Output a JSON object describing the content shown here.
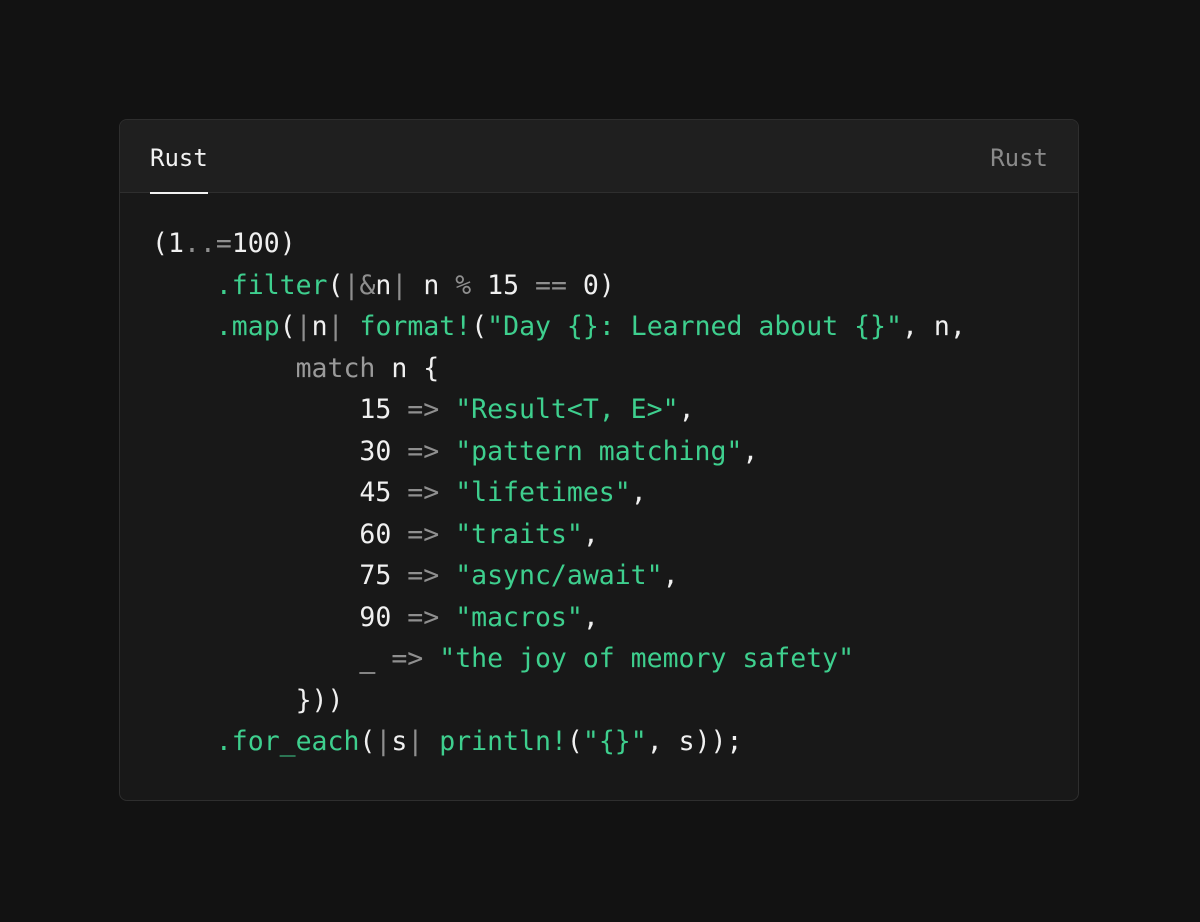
{
  "tab": {
    "label": "Rust"
  },
  "language_label": "Rust",
  "colors": {
    "background": "#121212",
    "card": "#181818",
    "header": "#1f1f1f",
    "border": "#2e2e2e",
    "text": "#f0f0f0",
    "muted": "#8f8f8f",
    "accent": "#3ecf8e"
  },
  "code_lines": [
    [
      {
        "t": "(",
        "k": "plain"
      },
      {
        "t": "1",
        "k": "plain"
      },
      {
        "t": "..",
        "k": "punct"
      },
      {
        "t": "=",
        "k": "punct"
      },
      {
        "t": "100",
        "k": "plain"
      },
      {
        "t": ")",
        "k": "plain"
      }
    ],
    [
      {
        "t": "    ",
        "k": "plain"
      },
      {
        "t": ".filter",
        "k": "fn"
      },
      {
        "t": "(",
        "k": "plain"
      },
      {
        "t": "|",
        "k": "punct"
      },
      {
        "t": "&",
        "k": "punct"
      },
      {
        "t": "n",
        "k": "plain"
      },
      {
        "t": "|",
        "k": "punct"
      },
      {
        "t": " n ",
        "k": "plain"
      },
      {
        "t": "%",
        "k": "punct"
      },
      {
        "t": " 15 ",
        "k": "plain"
      },
      {
        "t": "==",
        "k": "punct"
      },
      {
        "t": " 0)",
        "k": "plain"
      }
    ],
    [
      {
        "t": "    ",
        "k": "plain"
      },
      {
        "t": ".map",
        "k": "fn"
      },
      {
        "t": "(",
        "k": "plain"
      },
      {
        "t": "|",
        "k": "punct"
      },
      {
        "t": "n",
        "k": "plain"
      },
      {
        "t": "|",
        "k": "punct"
      },
      {
        "t": " ",
        "k": "plain"
      },
      {
        "t": "format!",
        "k": "fn"
      },
      {
        "t": "(",
        "k": "plain"
      },
      {
        "t": "\"Day {}: Learned about {}\"",
        "k": "str"
      },
      {
        "t": ", n,",
        "k": "plain"
      }
    ],
    [
      {
        "t": "         ",
        "k": "plain"
      },
      {
        "t": "match",
        "k": "kw"
      },
      {
        "t": " n {",
        "k": "plain"
      }
    ],
    [
      {
        "t": "             ",
        "k": "plain"
      },
      {
        "t": "15 ",
        "k": "plain"
      },
      {
        "t": "=>",
        "k": "punct"
      },
      {
        "t": " ",
        "k": "plain"
      },
      {
        "t": "\"Result<T, E>\"",
        "k": "str"
      },
      {
        "t": ",",
        "k": "plain"
      }
    ],
    [
      {
        "t": "             ",
        "k": "plain"
      },
      {
        "t": "30 ",
        "k": "plain"
      },
      {
        "t": "=>",
        "k": "punct"
      },
      {
        "t": " ",
        "k": "plain"
      },
      {
        "t": "\"pattern matching\"",
        "k": "str"
      },
      {
        "t": ",",
        "k": "plain"
      }
    ],
    [
      {
        "t": "             ",
        "k": "plain"
      },
      {
        "t": "45 ",
        "k": "plain"
      },
      {
        "t": "=>",
        "k": "punct"
      },
      {
        "t": " ",
        "k": "plain"
      },
      {
        "t": "\"lifetimes\"",
        "k": "str"
      },
      {
        "t": ",",
        "k": "plain"
      }
    ],
    [
      {
        "t": "             ",
        "k": "plain"
      },
      {
        "t": "60 ",
        "k": "plain"
      },
      {
        "t": "=>",
        "k": "punct"
      },
      {
        "t": " ",
        "k": "plain"
      },
      {
        "t": "\"traits\"",
        "k": "str"
      },
      {
        "t": ",",
        "k": "plain"
      }
    ],
    [
      {
        "t": "             ",
        "k": "plain"
      },
      {
        "t": "75 ",
        "k": "plain"
      },
      {
        "t": "=>",
        "k": "punct"
      },
      {
        "t": " ",
        "k": "plain"
      },
      {
        "t": "\"async/await\"",
        "k": "str"
      },
      {
        "t": ",",
        "k": "plain"
      }
    ],
    [
      {
        "t": "             ",
        "k": "plain"
      },
      {
        "t": "90 ",
        "k": "plain"
      },
      {
        "t": "=>",
        "k": "punct"
      },
      {
        "t": " ",
        "k": "plain"
      },
      {
        "t": "\"macros\"",
        "k": "str"
      },
      {
        "t": ",",
        "k": "plain"
      }
    ],
    [
      {
        "t": "             ",
        "k": "plain"
      },
      {
        "t": "_ ",
        "k": "plain"
      },
      {
        "t": "=>",
        "k": "punct"
      },
      {
        "t": " ",
        "k": "plain"
      },
      {
        "t": "\"the joy of memory safety\"",
        "k": "str"
      }
    ],
    [
      {
        "t": "         ",
        "k": "plain"
      },
      {
        "t": "}))",
        "k": "plain"
      }
    ],
    [
      {
        "t": "    ",
        "k": "plain"
      },
      {
        "t": ".for_each",
        "k": "fn"
      },
      {
        "t": "(",
        "k": "plain"
      },
      {
        "t": "|",
        "k": "punct"
      },
      {
        "t": "s",
        "k": "plain"
      },
      {
        "t": "|",
        "k": "punct"
      },
      {
        "t": " ",
        "k": "plain"
      },
      {
        "t": "println!",
        "k": "fn"
      },
      {
        "t": "(",
        "k": "plain"
      },
      {
        "t": "\"{}\"",
        "k": "str"
      },
      {
        "t": ", s));",
        "k": "plain"
      }
    ]
  ]
}
